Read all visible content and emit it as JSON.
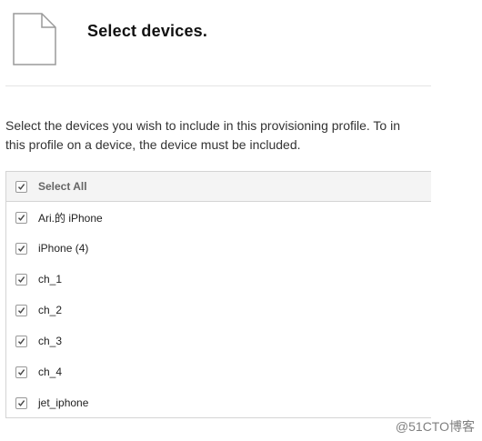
{
  "header": {
    "title": "Select devices.",
    "icon": "document-icon"
  },
  "description": {
    "line1": "Select the devices you wish to include in this provisioning profile. To in",
    "line2": "this profile on a device, the device must be included."
  },
  "device_list": {
    "select_all_label": "Select All",
    "select_all_checked": true,
    "devices": [
      {
        "name": "Ari.的 iPhone",
        "checked": true
      },
      {
        "name": "iPhone (4)",
        "checked": true
      },
      {
        "name": "ch_1",
        "checked": true
      },
      {
        "name": "ch_2",
        "checked": true
      },
      {
        "name": "ch_3",
        "checked": true
      },
      {
        "name": "ch_4",
        "checked": true
      },
      {
        "name": "jet_iphone",
        "checked": true
      }
    ]
  },
  "watermark": "@51CTO博客"
}
